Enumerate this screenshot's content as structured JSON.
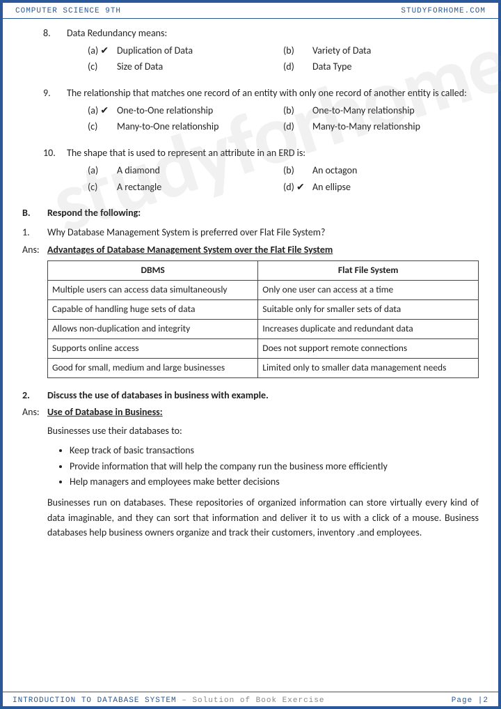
{
  "header": {
    "left": "COMPUTER SCIENCE 9TH",
    "right": "STUDYFORHOME.COM"
  },
  "watermark": "studyforhome.com",
  "mcq": [
    {
      "num": "8.",
      "q": "Data Redundancy means:",
      "opts": [
        {
          "l": "(a) ✔",
          "t": "Duplication of Data"
        },
        {
          "l": "(b)",
          "t": "Variety of Data"
        },
        {
          "l": "(c)",
          "t": "Size of Data"
        },
        {
          "l": "(d)",
          "t": "Data Type"
        }
      ]
    },
    {
      "num": "9.",
      "q": "The relationship that matches one record of an entity with only one record of another entity is called:",
      "opts": [
        {
          "l": "(a) ✔",
          "t": "One-to-One relationship"
        },
        {
          "l": "(b)",
          "t": "One-to-Many relationship"
        },
        {
          "l": "(c)",
          "t": "Many-to-One relationship"
        },
        {
          "l": "(d)",
          "t": "Many-to-Many relationship"
        }
      ]
    },
    {
      "num": "10.",
      "q": "The shape that is used to represent an attribute in an ERD is:",
      "opts": [
        {
          "l": "(a)",
          "t": "A diamond"
        },
        {
          "l": "(b)",
          "t": "An octagon"
        },
        {
          "l": "(c)",
          "t": "A rectangle"
        },
        {
          "l": "(d) ✔",
          "t": "An ellipse"
        }
      ]
    }
  ],
  "sectionB": {
    "label": "B.",
    "text": "Respond the following:"
  },
  "q1": {
    "num": "1.",
    "text": "Why Database Management System is preferred over Flat File System?"
  },
  "ans1": {
    "label": "Ans:",
    "text": "Advantages of Database Management System over the Flat File System"
  },
  "table": {
    "h1": "DBMS",
    "h2": "Flat File System",
    "rows": [
      [
        "Multiple users can access data simultaneously",
        "Only one user can access at a time"
      ],
      [
        "Capable of handling huge sets of data",
        "Suitable only for smaller sets of data"
      ],
      [
        "Allows non-duplication and integrity",
        "Increases duplicate and redundant data"
      ],
      [
        "Supports online access",
        "Does not support remote connections"
      ],
      [
        "Good for small, medium and large businesses",
        "Limited only to smaller data management needs"
      ]
    ]
  },
  "q2": {
    "num": "2.",
    "text": "Discuss the use of databases in business with example."
  },
  "ans2": {
    "label": "Ans:",
    "text": "Use of Database in Business:"
  },
  "intro2": "Businesses use their databases to:",
  "bullets": [
    "Keep track of basic transactions",
    "Provide information that will help the company run the business more efficiently",
    "Help managers and employees make better decisions"
  ],
  "para2": "Businesses run on databases. These repositories of organized information can store virtually every kind of data imaginable, and they can sort that information and deliver it to us with a click of a mouse. Business databases help business owners organize and track their customers, inventory .and employees.",
  "footer": {
    "title": "INTRODUCTION TO DATABASE SYSTEM",
    "sub": " – Solution of Book Exercise",
    "page": "Page |2"
  }
}
